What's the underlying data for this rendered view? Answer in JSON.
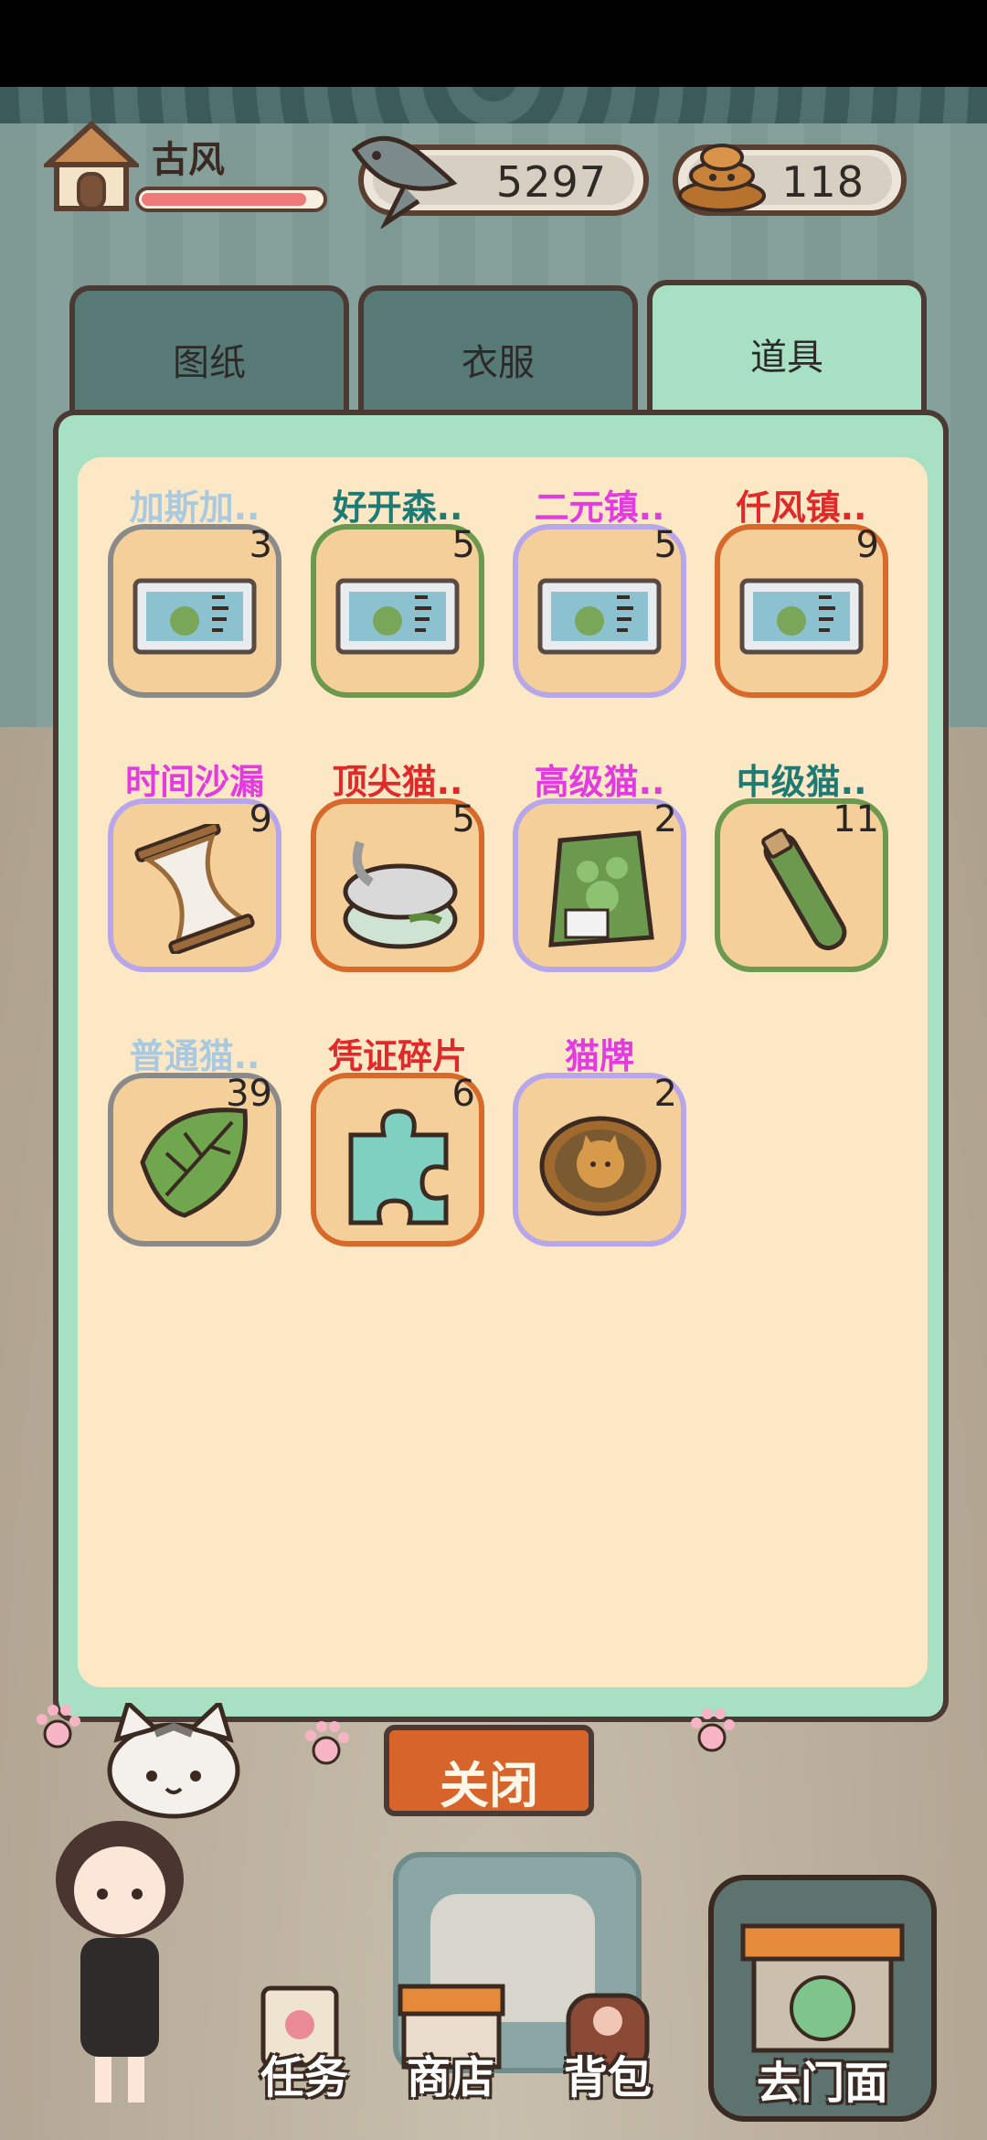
{
  "player": {
    "name": "古风",
    "hp_fraction": 0.92
  },
  "currency": {
    "fish": "5297",
    "poop": "118",
    "fish_icon": "fish-icon",
    "poop_icon": "poop-icon"
  },
  "tabs": [
    {
      "label": "图纸",
      "active": false
    },
    {
      "label": "衣服",
      "active": false
    },
    {
      "label": "道具",
      "active": true
    }
  ],
  "items": [
    {
      "name": "加斯加..",
      "count": "3",
      "name_color": "#a9c9e0",
      "border": "#8a8a8a",
      "icon": "ticket-icon"
    },
    {
      "name": "好开森..",
      "count": "5",
      "name_color": "#1f7a74",
      "border": "#6b9a4e",
      "icon": "ticket-icon"
    },
    {
      "name": "二元镇..",
      "count": "5",
      "name_color": "#e23ce0",
      "border": "#b8a6ea",
      "icon": "ticket-icon"
    },
    {
      "name": "仟风镇..",
      "count": "9",
      "name_color": "#e02a2a",
      "border": "#d76a2a",
      "icon": "ticket-icon"
    },
    {
      "name": "时间沙漏",
      "count": "9",
      "name_color": "#e23ce0",
      "border": "#b8a6ea",
      "icon": "hourglass-icon"
    },
    {
      "name": "顶尖猫..",
      "count": "5",
      "name_color": "#e02a2a",
      "border": "#d76a2a",
      "icon": "cat-food-can-icon"
    },
    {
      "name": "高级猫..",
      "count": "2",
      "name_color": "#e23ce0",
      "border": "#b8a6ea",
      "icon": "cat-food-bag-icon"
    },
    {
      "name": "中级猫..",
      "count": "11",
      "name_color": "#1f7a74",
      "border": "#6b9a4e",
      "icon": "cat-food-tube-icon"
    },
    {
      "name": "普通猫..",
      "count": "39",
      "name_color": "#a9c9e0",
      "border": "#8a8a8a",
      "icon": "leaf-icon"
    },
    {
      "name": "凭证碎片",
      "count": "6",
      "name_color": "#e02a2a",
      "border": "#d76a2a",
      "icon": "puzzle-piece-icon"
    },
    {
      "name": "猫牌",
      "count": "2",
      "name_color": "#e23ce0",
      "border": "#b8a6ea",
      "icon": "cat-medal-icon"
    }
  ],
  "close_button": "关闭",
  "nav": {
    "tasks": "任务",
    "shop": "商店",
    "bag": "背包",
    "go_store": "去门面"
  }
}
